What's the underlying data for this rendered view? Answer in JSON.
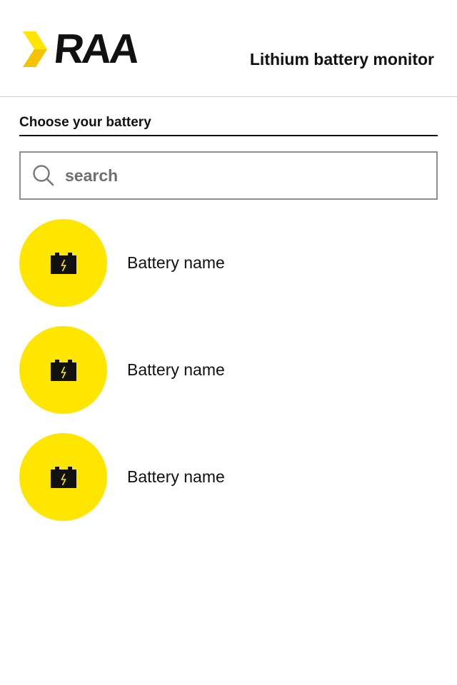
{
  "header": {
    "brand": "RAA",
    "title": "Lithium battery monitor"
  },
  "main": {
    "heading": "Choose your battery",
    "search": {
      "placeholder": "search",
      "value": ""
    },
    "batteries": [
      {
        "label": "Battery name",
        "icon": "battery-icon"
      },
      {
        "label": "Battery name",
        "icon": "battery-icon"
      },
      {
        "label": "Battery name",
        "icon": "battery-icon"
      }
    ]
  },
  "colors": {
    "accent": "#ffe600",
    "text": "#111111",
    "border": "#8f8f8f"
  }
}
